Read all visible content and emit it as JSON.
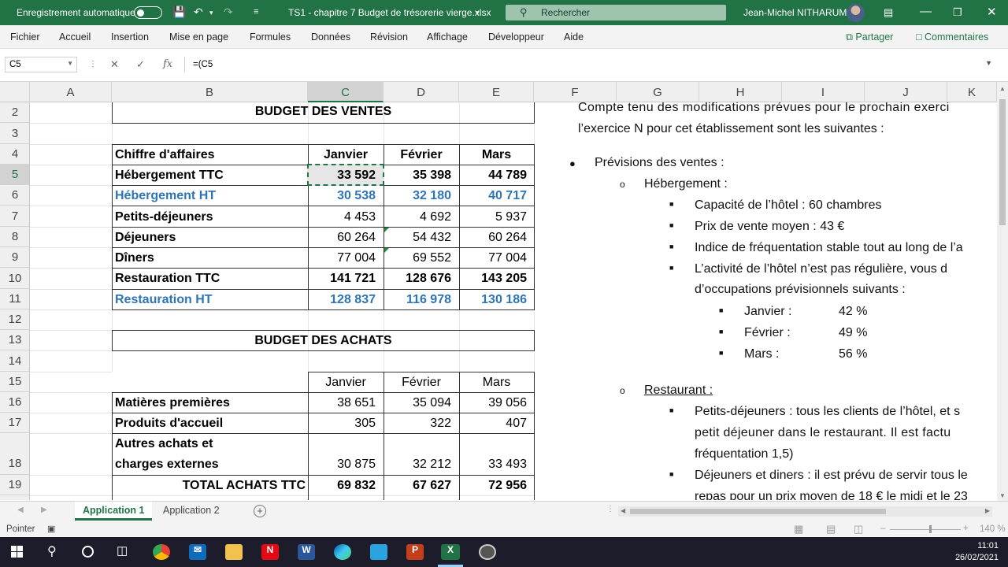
{
  "titlebar": {
    "autosave_label": "Enregistrement automatique",
    "file_title": "TS1 - chapitre 7 Budget de trésorerie vierge.xlsx",
    "search_placeholder": "Rechercher",
    "user_name": "Jean-Michel NITHARUM"
  },
  "ribbon": {
    "tabs": [
      "Fichier",
      "Accueil",
      "Insertion",
      "Mise en page",
      "Formules",
      "Données",
      "Révision",
      "Affichage",
      "Développeur",
      "Aide"
    ],
    "share_label": "Partager",
    "comments_label": "Commentaires"
  },
  "formula": {
    "namebox": "C5",
    "content": "=(C5"
  },
  "columns": [
    "A",
    "B",
    "C",
    "D",
    "E",
    "F",
    "G",
    "H",
    "I",
    "J",
    "K"
  ],
  "rows": [
    "2",
    "3",
    "4",
    "5",
    "6",
    "7",
    "8",
    "9",
    "10",
    "11",
    "12",
    "13",
    "14",
    "15",
    "16",
    "17",
    "18",
    "19"
  ],
  "sales": {
    "title": "BUDGET DES VENTES",
    "header": [
      "Chiffre d'affaires",
      "Janvier",
      "Février",
      "Mars"
    ],
    "rows": [
      [
        "Hébergement TTC",
        "33 592",
        "35 398",
        "44 789"
      ],
      [
        "Hébergement HT",
        "30 538",
        "32 180",
        "40 717"
      ],
      [
        "Petits-déjeuners",
        "4 453",
        "4 692",
        "5 937"
      ],
      [
        "Déjeuners",
        "60 264",
        "54 432",
        "60 264"
      ],
      [
        "Dîners",
        "77 004",
        "69 552",
        "77 004"
      ],
      [
        "Restauration TTC",
        "141 721",
        "128 676",
        "143 205"
      ],
      [
        "Restauration HT",
        "128 837",
        "116 978",
        "130 186"
      ]
    ]
  },
  "purchases": {
    "title": "BUDGET DES ACHATS",
    "header": [
      "",
      "Janvier",
      "Février",
      "Mars"
    ],
    "rows": [
      [
        "Matières premières",
        "38 651",
        "35 094",
        "39 056"
      ],
      [
        "Produits d'accueil",
        "305",
        "322",
        "407"
      ],
      [
        "Autres achats et",
        "",
        "",
        ""
      ],
      [
        "charges externes",
        "30 875",
        "32 212",
        "33 493"
      ],
      [
        "TOTAL ACHATS TTC",
        "69 832",
        "67 627",
        "72 956"
      ]
    ]
  },
  "doc": {
    "line1": "Compte tenu des modifications prévues pour le prochain exerci",
    "line2": "l’exercice N pour cet établissement sont les suivantes :",
    "prev_ventes": "Prévisions des ventes :",
    "hebergement": "Hébergement :",
    "cap": "Capacité de l’hôtel : 60 chambres",
    "prix": "Prix de vente moyen : 43 €",
    "indice": "Indice de fréquentation stable tout au long de l’a",
    "activite1": "L’activité de l’hôtel n’est pas régulière, vous d",
    "activite2": "d’occupations prévisionnels suivants :",
    "months": [
      {
        "m": "Janvier :",
        "v": "42 %"
      },
      {
        "m": "Février :",
        "v": "49 %"
      },
      {
        "m": "Mars :",
        "v": "56 %"
      }
    ],
    "restaurant": "Restaurant :",
    "pdj1": "Petits-déjeuners : tous les clients de l’hôtel, et s",
    "pdj2": "petit déjeuner dans le restaurant. Il est factu",
    "pdj3": "fréquentation 1,5)",
    "dej1": "Déjeuners et diners : il est prévu de servir tous le",
    "dej2": "repas pour un prix moyen de 18 € le midi et le 23"
  },
  "sheets": [
    "Application 1",
    "Application 2"
  ],
  "status": {
    "mode": "Pointer",
    "zoom": "140 %"
  },
  "clock": {
    "time": "11:01",
    "date": "26/02/2021"
  },
  "colors": {
    "excel_green": "#217346",
    "ht_blue": "#2e75b6"
  }
}
